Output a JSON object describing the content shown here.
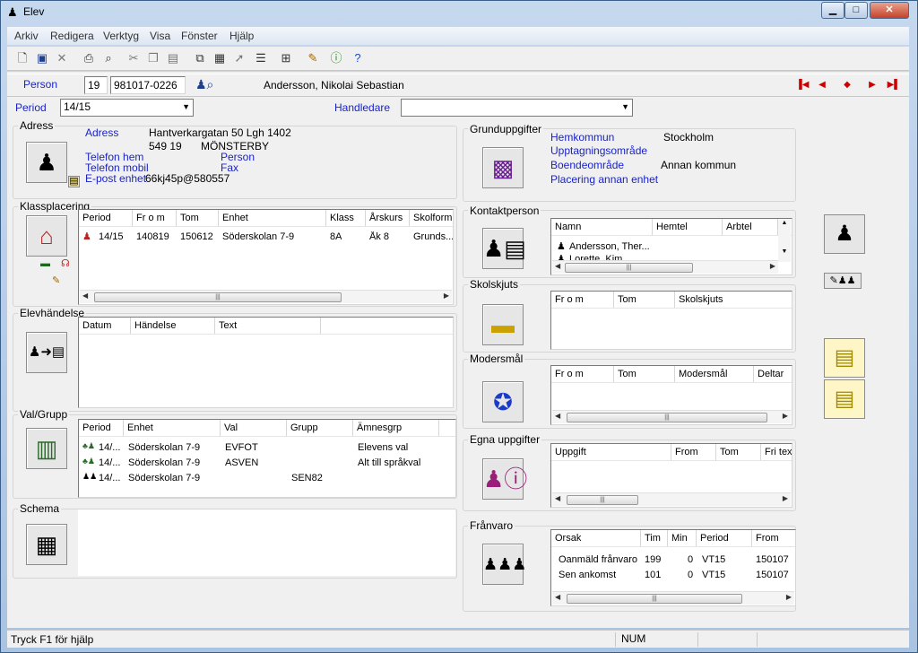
{
  "window": {
    "title": "Elev",
    "minimize": "▁",
    "maximize": "□",
    "close": "✕"
  },
  "menu": [
    "Arkiv",
    "Redigera",
    "Verktyg",
    "Visa",
    "Fönster",
    "Hjälp"
  ],
  "toolbar_icons": [
    "new-icon",
    "save-icon",
    "delete-icon",
    "print-icon",
    "find-icon",
    "cut-icon",
    "copy-icon",
    "paste-icon",
    "preview-icon",
    "clipboard-icon",
    "pin-icon",
    "list-icon",
    "properties-icon",
    "edit-icon",
    "info-icon",
    "help-icon"
  ],
  "person": {
    "label": "Person",
    "prefix": "19",
    "number": "981017-0226",
    "name": "Andersson, Nikolai Sebastian"
  },
  "period": {
    "label": "Period",
    "value": "14/15"
  },
  "handledare": {
    "label": "Handledare",
    "value": ""
  },
  "adress": {
    "group": "Adress",
    "adress_label": "Adress",
    "street": "Hantverkargatan 50 Lgh 1402",
    "zip": "549 19",
    "city": "MÖNSTERBY",
    "telefon_hem_label": "Telefon hem",
    "telefon_mobil_label": "Telefon mobil",
    "epost_label": "E-post enhet",
    "epost": "66kj45p@580557",
    "person_label": "Person",
    "fax_label": "Fax"
  },
  "klassplacering": {
    "group": "Klassplacering",
    "headers": [
      "Period",
      "Fr o m",
      "Tom",
      "Enhet",
      "Klass",
      "Årskurs",
      "Skolform"
    ],
    "rows": [
      [
        "14/15",
        "140819",
        "150612",
        "Söderskolan 7-9",
        "8A",
        "Åk 8",
        "Grunds..."
      ]
    ]
  },
  "elevhandelse": {
    "group": "Elevhändelse",
    "headers": [
      "Datum",
      "Händelse",
      "Text"
    ]
  },
  "valgrupp": {
    "group": "Val/Grupp",
    "headers": [
      "Period",
      "Enhet",
      "Val",
      "Grupp",
      "Ämnesgrp"
    ],
    "rows": [
      [
        "14/...",
        "Söderskolan 7-9",
        "EVFOT",
        "",
        "Elevens val"
      ],
      [
        "14/...",
        "Söderskolan 7-9",
        "ASVEN",
        "",
        "Alt till språkval"
      ],
      [
        "14/...",
        "Söderskolan 7-9",
        "",
        "SEN82",
        ""
      ]
    ]
  },
  "schema": {
    "group": "Schema"
  },
  "grunduppgifter": {
    "group": "Grunduppgifter",
    "hemkommun_label": "Hemkommun",
    "hemkommun": "Stockholm",
    "upptagning_label": "Upptagningsområde",
    "boende_label": "Boendeområde",
    "boende": "Annan kommun",
    "placering_label": "Placering annan enhet"
  },
  "kontaktperson": {
    "group": "Kontaktperson",
    "headers": [
      "Namn",
      "Hemtel",
      "Arbtel"
    ],
    "rows": [
      [
        "Andersson, Ther..."
      ],
      [
        "Lorette, Kim"
      ]
    ]
  },
  "skolskjuts": {
    "group": "Skolskjuts",
    "headers": [
      "Fr o m",
      "Tom",
      "Skolskjuts"
    ]
  },
  "modersmal": {
    "group": "Modersmål",
    "headers": [
      "Fr o m",
      "Tom",
      "Modersmål",
      "Deltar"
    ]
  },
  "egna": {
    "group": "Egna uppgifter",
    "headers": [
      "Uppgift",
      "From",
      "Tom",
      "Fri text"
    ]
  },
  "franvaro": {
    "group": "Frånvaro",
    "headers": [
      "Orsak",
      "Tim",
      "Min",
      "Period",
      "From"
    ],
    "rows": [
      [
        "Oanmäld frånvaro",
        "199",
        "0",
        "VT15",
        "150107"
      ],
      [
        "Sen ankomst",
        "101",
        "0",
        "VT15",
        "150107"
      ]
    ]
  },
  "status": {
    "help": "Tryck F1 för hjälp",
    "num": "NUM"
  }
}
